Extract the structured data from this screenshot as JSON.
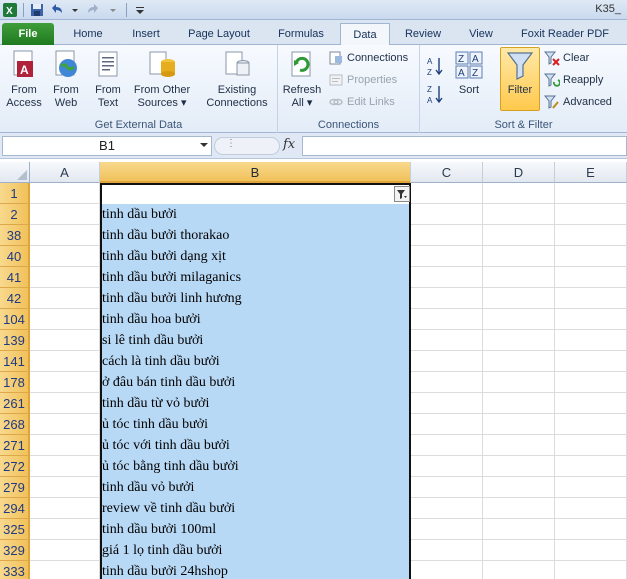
{
  "window": {
    "title": "K35_"
  },
  "qat": {
    "icons": [
      "excel-logo-icon",
      "save-icon",
      "undo-icon",
      "redo-icon",
      "customize-icon"
    ]
  },
  "tabs": [
    {
      "label": "File"
    },
    {
      "label": "Home"
    },
    {
      "label": "Insert"
    },
    {
      "label": "Page Layout"
    },
    {
      "label": "Formulas"
    },
    {
      "label": "Data"
    },
    {
      "label": "Review"
    },
    {
      "label": "View"
    },
    {
      "label": "Foxit Reader PDF"
    }
  ],
  "ribbon": {
    "external": {
      "label": "Get External Data",
      "from_access": [
        "From",
        "Access"
      ],
      "from_web": [
        "From",
        "Web"
      ],
      "from_text": [
        "From",
        "Text"
      ],
      "from_other": [
        "From Other",
        "Sources ▾"
      ],
      "existing": [
        "Existing",
        "Connections"
      ]
    },
    "connections": {
      "label": "Connections",
      "refresh": [
        "Refresh",
        "All ▾"
      ],
      "connections": "Connections",
      "properties": "Properties",
      "edit_links": "Edit Links"
    },
    "sort_filter": {
      "label": "Sort & Filter",
      "sort": "Sort",
      "filter": "Filter",
      "clear": "Clear",
      "reapply": "Reapply",
      "advanced": "Advanced"
    }
  },
  "formula_bar": {
    "name_box": "B1",
    "fx": "fx",
    "value": ""
  },
  "columns": [
    "A",
    "B",
    "C",
    "D",
    "E"
  ],
  "rows": [
    {
      "num": "1",
      "b": ""
    },
    {
      "num": "2",
      "b": "tinh dầu bưởi"
    },
    {
      "num": "38",
      "b": "tinh dầu bưởi thorakao"
    },
    {
      "num": "40",
      "b": "tinh dầu bưởi dạng xịt"
    },
    {
      "num": "41",
      "b": "tinh dầu bưởi milaganics"
    },
    {
      "num": "42",
      "b": "tinh dầu bưởi linh hương"
    },
    {
      "num": "104",
      "b": "tinh dầu hoa bưởi"
    },
    {
      "num": "139",
      "b": "si lê tinh dầu bưởi"
    },
    {
      "num": "141",
      "b": "cách là tinh dầu bưởi"
    },
    {
      "num": "178",
      "b": "ở đâu bán tinh dầu bưởi"
    },
    {
      "num": "261",
      "b": "tinh dầu từ vỏ bưởi"
    },
    {
      "num": "268",
      "b": "ủ tóc tinh dầu bưởi"
    },
    {
      "num": "271",
      "b": "ủ tóc với tinh dầu bưởi"
    },
    {
      "num": "272",
      "b": "ủ tóc bằng tinh dầu bưởi"
    },
    {
      "num": "279",
      "b": "tinh dầu vỏ bưởi"
    },
    {
      "num": "294",
      "b": "review về tinh dầu bưởi"
    },
    {
      "num": "325",
      "b": "tinh dầu bưởi 100ml"
    },
    {
      "num": "329",
      "b": "giá 1 lọ tinh dầu bưởi"
    },
    {
      "num": "333",
      "b": "tinh dầu bưởi 24hshop"
    }
  ]
}
